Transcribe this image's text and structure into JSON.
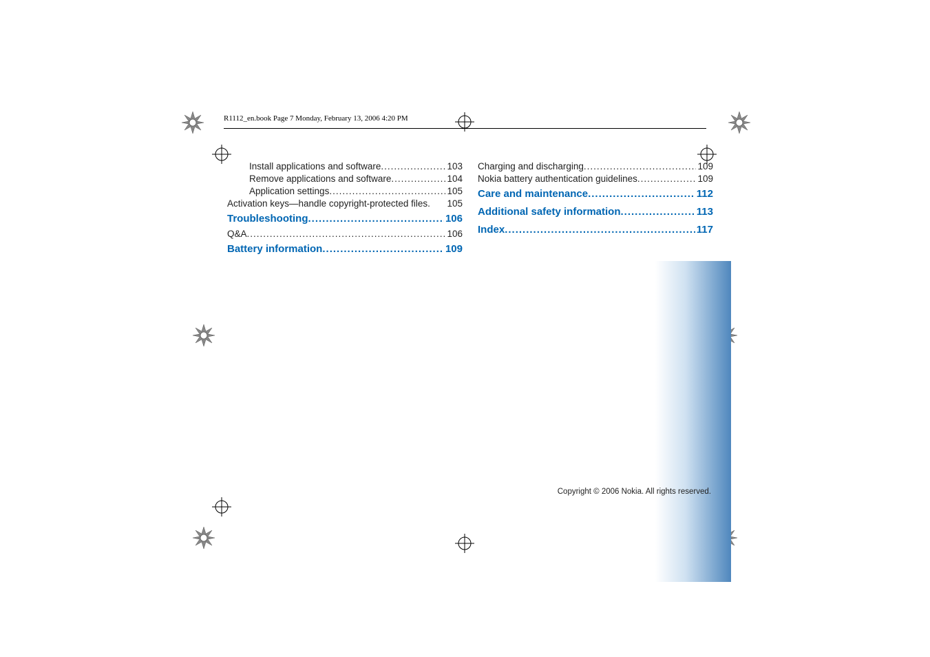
{
  "header": {
    "running_title": "R1112_en.book  Page 7  Monday, February 13, 2006  4:20 PM"
  },
  "leader_dots": "..................................................................................................................",
  "col_left": [
    {
      "label": "Install applications and software",
      "page": "103",
      "indent": 2,
      "chapter": false,
      "leader": true
    },
    {
      "label": "Remove applications and software",
      "page": "104",
      "indent": 2,
      "chapter": false,
      "leader": true
    },
    {
      "label": "Application settings",
      "page": "105",
      "indent": 2,
      "chapter": false,
      "leader": true
    },
    {
      "label": "Activation keys—handle copyright-protected files.",
      "page": "105",
      "indent": 0,
      "chapter": false,
      "leader": false
    },
    {
      "label": "Troubleshooting",
      "page": "106",
      "indent": 0,
      "chapter": true,
      "leader": true
    },
    {
      "label": "Q&A",
      "page": "106",
      "indent": 0,
      "chapter": false,
      "leader": true
    },
    {
      "label": "Battery information",
      "page": "109",
      "indent": 0,
      "chapter": true,
      "leader": true
    }
  ],
  "col_right": [
    {
      "label": "Charging and discharging",
      "page": "109",
      "indent": 0,
      "chapter": false,
      "leader": true
    },
    {
      "label": "Nokia battery authentication guidelines",
      "page": "109",
      "indent": 0,
      "chapter": false,
      "leader": true
    },
    {
      "label": "Care and maintenance",
      "page": "112",
      "indent": 0,
      "chapter": true,
      "leader": true
    },
    {
      "label": "Additional safety information",
      "page": "113",
      "indent": 0,
      "chapter": true,
      "leader": true
    },
    {
      "label": "Index",
      "page": "117",
      "indent": 0,
      "chapter": true,
      "leader": true
    }
  ],
  "footer": {
    "copyright": "Copyright © 2006 Nokia. All rights reserved."
  }
}
